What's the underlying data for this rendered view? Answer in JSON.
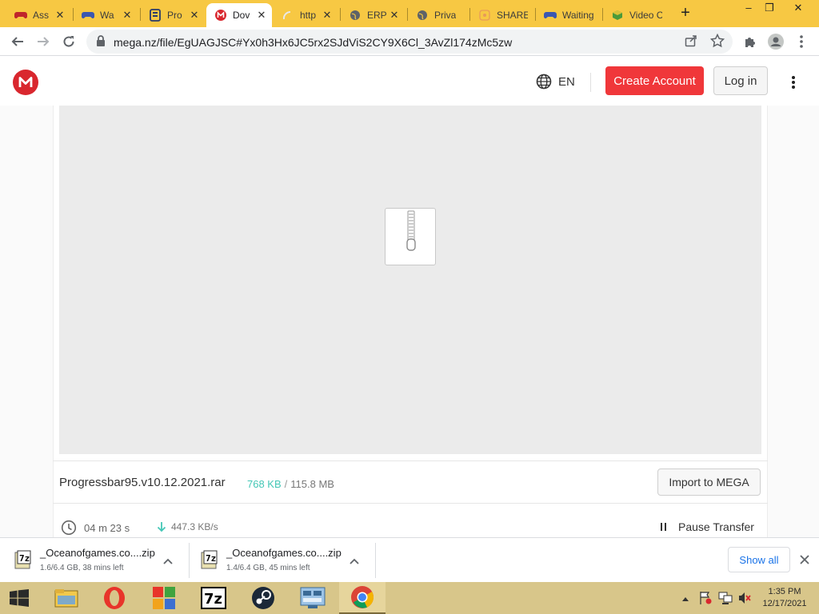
{
  "tabs": [
    {
      "label": "Ass",
      "icon": "gamepad-icon"
    },
    {
      "label": "Wa",
      "icon": "gamepad-icon"
    },
    {
      "label": "Pro",
      "icon": "document-icon"
    },
    {
      "label": "Dov",
      "icon": "mega-icon",
      "active": true
    },
    {
      "label": "http",
      "icon": "loading-icon"
    },
    {
      "label": "ERP",
      "icon": "globe-icon"
    },
    {
      "label": "Privacy",
      "icon": "globe-icon"
    },
    {
      "label": "SHAREit",
      "icon": "shareit-icon"
    },
    {
      "label": "Waiting",
      "icon": "gamepad-icon"
    },
    {
      "label": "Video C",
      "icon": "cube-icon"
    }
  ],
  "new_tab_symbol": "+",
  "window_controls": {
    "minimize": "–",
    "restore": "❐",
    "close": "✕"
  },
  "address_bar": {
    "url": "mega.nz/file/EgUAGJSC#Yx0h3Hx6JC5rx2SJdViS2CY9X6Cl_3AvZl174zMc5zw"
  },
  "header": {
    "language": "EN",
    "create_account": "Create Account",
    "login": "Log in"
  },
  "file": {
    "name": "Progressbar95.v10.12.2021.rar",
    "downloaded": "768 KB",
    "separator": "/",
    "total": "115.8 MB",
    "import_button": "Import to MEGA",
    "time_remaining": "04 m  23 s",
    "speed": "447.3 KB/s",
    "pause_button": "Pause Transfer"
  },
  "downloads": [
    {
      "name": "_Oceanofgames.co....zip",
      "status": "1.6/6.4 GB, 38 mins left"
    },
    {
      "name": "_Oceanofgames.co....zip",
      "status": "1.4/6.4 GB, 45 mins left"
    }
  ],
  "shelf": {
    "show_all": "Show all"
  },
  "taskbar": {
    "items": [
      "file-explorer-icon",
      "opera-icon",
      "app-icon",
      "7zip-icon",
      "steam-icon",
      "control-panel-icon",
      "chrome-icon"
    ],
    "time": "1:35 PM",
    "date": "12/17/2021"
  },
  "colors": {
    "tabstrip": "#f7c843",
    "mega_red": "#d9272e",
    "create_button": "#f0373a",
    "progress_teal": "#44c7b6",
    "taskbar": "#d8c68a"
  }
}
